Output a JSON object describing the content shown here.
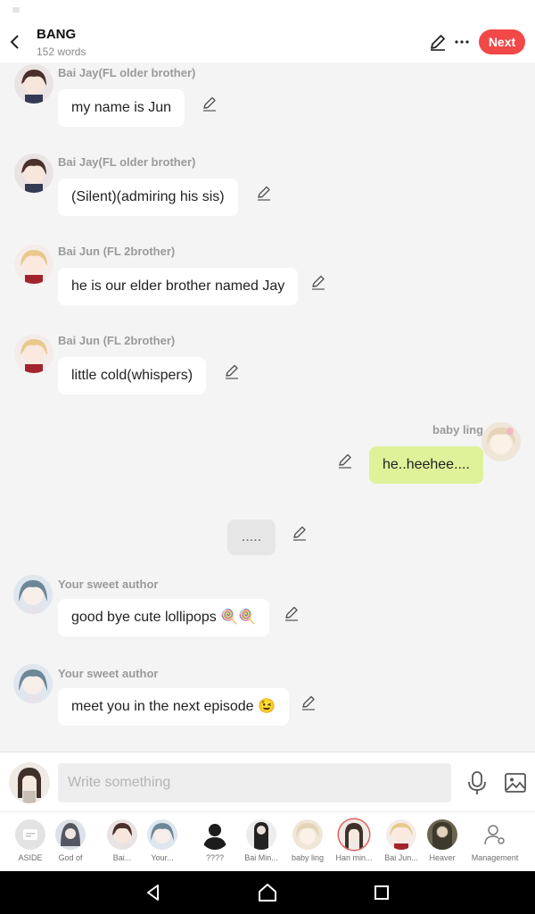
{
  "header": {
    "title": "BANG",
    "word_count": "152 words",
    "next_label": "Next",
    "icons": [
      "back-arrow-icon",
      "edit-pencil-icon",
      "more-dots-icon"
    ]
  },
  "messages": [
    {
      "speaker": "Bai Jay(FL older brother)",
      "text": "my name is Jun",
      "side": "left"
    },
    {
      "speaker": "Bai Jay(FL older brother)",
      "text": "(Silent)(admiring his sis)",
      "side": "left"
    },
    {
      "speaker": "Bai Jun (FL 2brother)",
      "text": "he is our elder brother named Jay",
      "side": "left"
    },
    {
      "speaker": "Bai Jun (FL 2brother)",
      "text": "little cold(whispers)",
      "side": "left"
    },
    {
      "speaker": "baby ling",
      "text": "he..heehee....",
      "side": "right"
    },
    {
      "speaker": "",
      "text": ".....",
      "side": "aside"
    },
    {
      "speaker": "Your sweet author",
      "text": "good bye cute lollipops 🍭🍭",
      "side": "left"
    },
    {
      "speaker": "Your sweet author",
      "text": "meet you in the next episode 😉",
      "side": "left"
    }
  ],
  "composer": {
    "placeholder": "Write something",
    "value": ""
  },
  "cast": {
    "aside_label": "ASIDE",
    "members": [
      "God of",
      "Bai...",
      "Your...",
      "????",
      "Bai Min...",
      "baby ling",
      "Han min...",
      "Bai Jun...",
      "Heaver"
    ],
    "selected": "Han min...",
    "management_label": "Management"
  },
  "colors": {
    "accent": "#f24848",
    "own_bubble": "#dff29a",
    "background": "#f4f4f4"
  }
}
